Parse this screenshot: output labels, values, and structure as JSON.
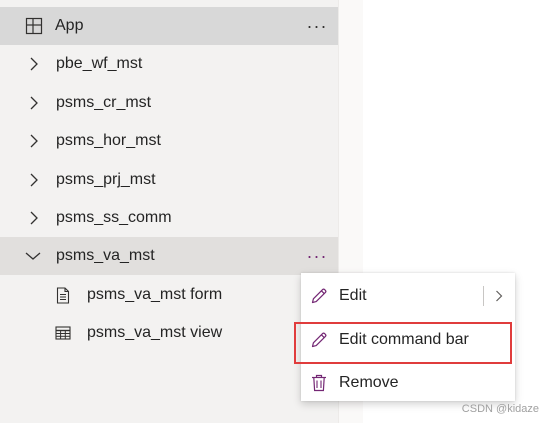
{
  "tree": {
    "app_row": {
      "label": "App",
      "more": "···"
    },
    "items": [
      {
        "label": "pbe_wf_mst"
      },
      {
        "label": "psms_cr_mst"
      },
      {
        "label": "psms_hor_mst"
      },
      {
        "label": "psms_prj_mst"
      },
      {
        "label": "psms_ss_comm"
      }
    ],
    "open_item": {
      "label": "psms_va_mst",
      "more": "···",
      "children": [
        {
          "label": "psms_va_mst form",
          "icon": "form-icon"
        },
        {
          "label": "psms_va_mst view",
          "icon": "table-view-icon"
        }
      ]
    }
  },
  "context_menu": {
    "items": [
      {
        "label": "Edit",
        "icon": "pencil-icon",
        "has_submenu": true
      },
      {
        "label": "Edit command bar",
        "icon": "pencil-icon",
        "highlighted": true
      },
      {
        "label": "Remove",
        "icon": "trash-icon"
      }
    ]
  },
  "colors": {
    "accent": "#742774",
    "highlight_border": "#e03c3c",
    "selected_row": "#d8d8d8",
    "panel_bg": "#f3f2f1"
  },
  "watermark": "CSDN @kidaze"
}
